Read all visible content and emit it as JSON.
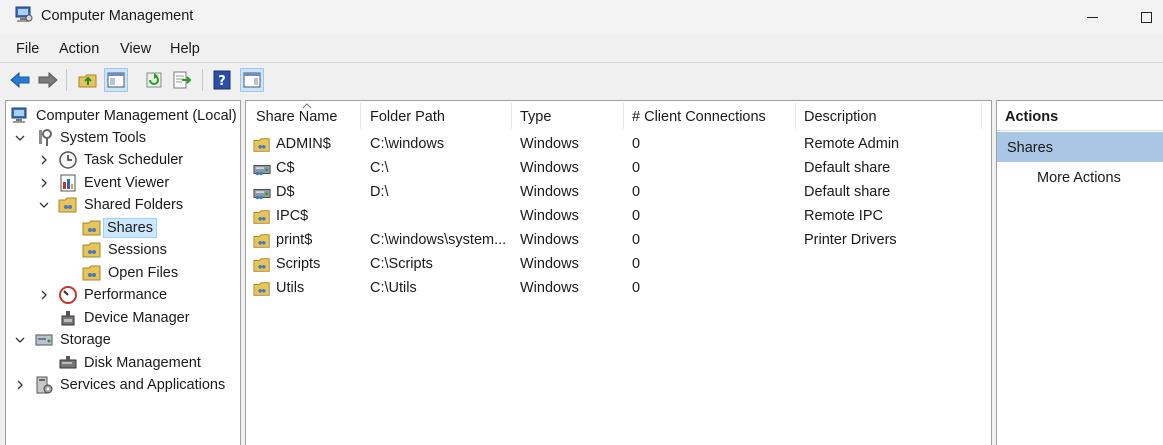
{
  "window": {
    "title": "Computer Management",
    "icon": "computer-management-icon"
  },
  "menu": [
    "File",
    "Action",
    "View",
    "Help"
  ],
  "toolbar": {
    "buttons": [
      "back-arrow-icon",
      "forward-arrow-icon",
      "up-folder-icon",
      "show-hide-console-tree-icon",
      "refresh-icon",
      "export-list-icon",
      "help-icon",
      "show-hide-action-pane-icon"
    ]
  },
  "tree": {
    "root": "Computer Management (Local)",
    "system_tools": "System Tools",
    "task_scheduler": "Task Scheduler",
    "event_viewer": "Event Viewer",
    "shared_folders": "Shared Folders",
    "shares": "Shares",
    "sessions": "Sessions",
    "open_files": "Open Files",
    "performance": "Performance",
    "device_manager": "Device Manager",
    "storage": "Storage",
    "disk_management": "Disk Management",
    "services_apps": "Services and Applications"
  },
  "table": {
    "columns": [
      "Share Name",
      "Folder Path",
      "Type",
      "# Client Connections",
      "Description"
    ],
    "rows": [
      {
        "name": "ADMIN$",
        "path": "C:\\windows",
        "type": "Windows",
        "connections": "0",
        "description": "Remote Admin",
        "icon": "shared-folder-icon"
      },
      {
        "name": "C$",
        "path": "C:\\",
        "type": "Windows",
        "connections": "0",
        "description": "Default share",
        "icon": "shared-drive-icon"
      },
      {
        "name": "D$",
        "path": "D:\\",
        "type": "Windows",
        "connections": "0",
        "description": "Default share",
        "icon": "shared-drive-icon"
      },
      {
        "name": "IPC$",
        "path": "",
        "type": "Windows",
        "connections": "0",
        "description": "Remote IPC",
        "icon": "shared-folder-icon"
      },
      {
        "name": "print$",
        "path": "C:\\windows\\system...",
        "type": "Windows",
        "connections": "0",
        "description": "Printer Drivers",
        "icon": "shared-folder-icon"
      },
      {
        "name": "Scripts",
        "path": "C:\\Scripts",
        "type": "Windows",
        "connections": "0",
        "description": "",
        "icon": "shared-folder-icon"
      },
      {
        "name": "Utils",
        "path": "C:\\Utils",
        "type": "Windows",
        "connections": "0",
        "description": "",
        "icon": "shared-folder-icon"
      }
    ]
  },
  "actions": {
    "header": "Actions",
    "section": "Shares",
    "more": "More Actions"
  },
  "colors": {
    "selection": "#cce8ff",
    "actions_section": "#a9c6e4"
  }
}
